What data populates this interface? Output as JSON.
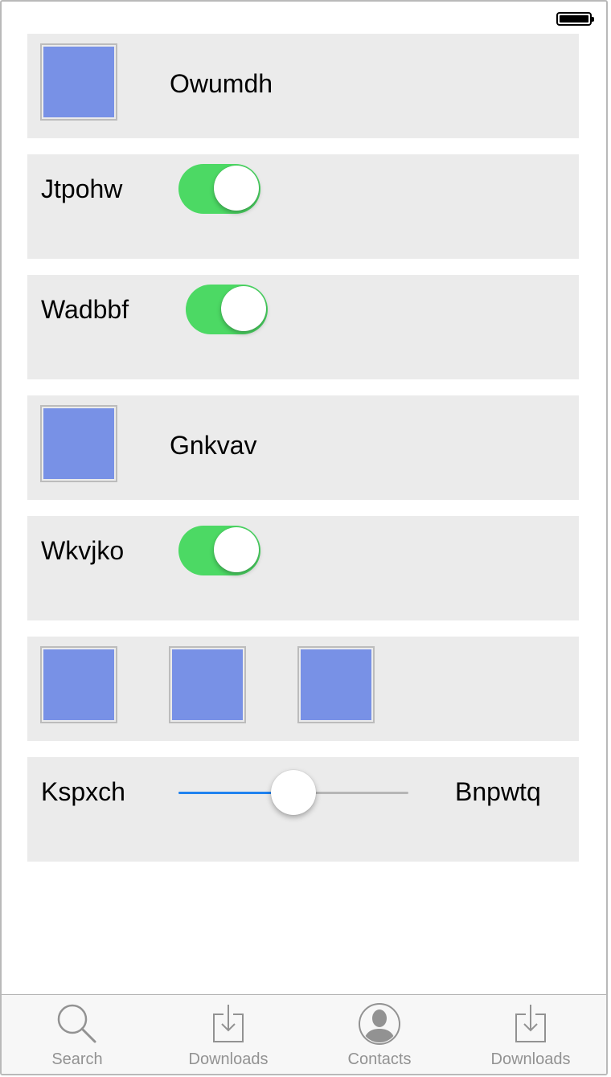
{
  "status_bar": {
    "battery_icon": "battery-full-icon"
  },
  "rows": [
    {
      "type": "image-label",
      "label": "Owumdh"
    },
    {
      "type": "switch",
      "label": "Jtpohw",
      "on": true
    },
    {
      "type": "switch",
      "label": "Wadbbf",
      "on": true
    },
    {
      "type": "image-label",
      "label": "Gnkvav"
    },
    {
      "type": "switch",
      "label": "Wkvjko",
      "on": true
    },
    {
      "type": "images"
    },
    {
      "type": "slider",
      "min_label": "Kspxch",
      "max_label": "Bnpwtq",
      "value": 0.5
    }
  ],
  "tabbar": {
    "tabs": [
      {
        "label": "Search",
        "icon": "search-icon"
      },
      {
        "label": "Downloads",
        "icon": "downloads-icon"
      },
      {
        "label": "Contacts",
        "icon": "contacts-icon"
      },
      {
        "label": "Downloads",
        "icon": "downloads-icon"
      }
    ]
  },
  "colors": {
    "row_background": "#ebebeb",
    "image_fill": "#7891e6",
    "switch_on": "#4cd964",
    "slider_min_track": "#1f82f0",
    "slider_max_track": "#b6b6b6",
    "tab_icon": "#929292"
  }
}
